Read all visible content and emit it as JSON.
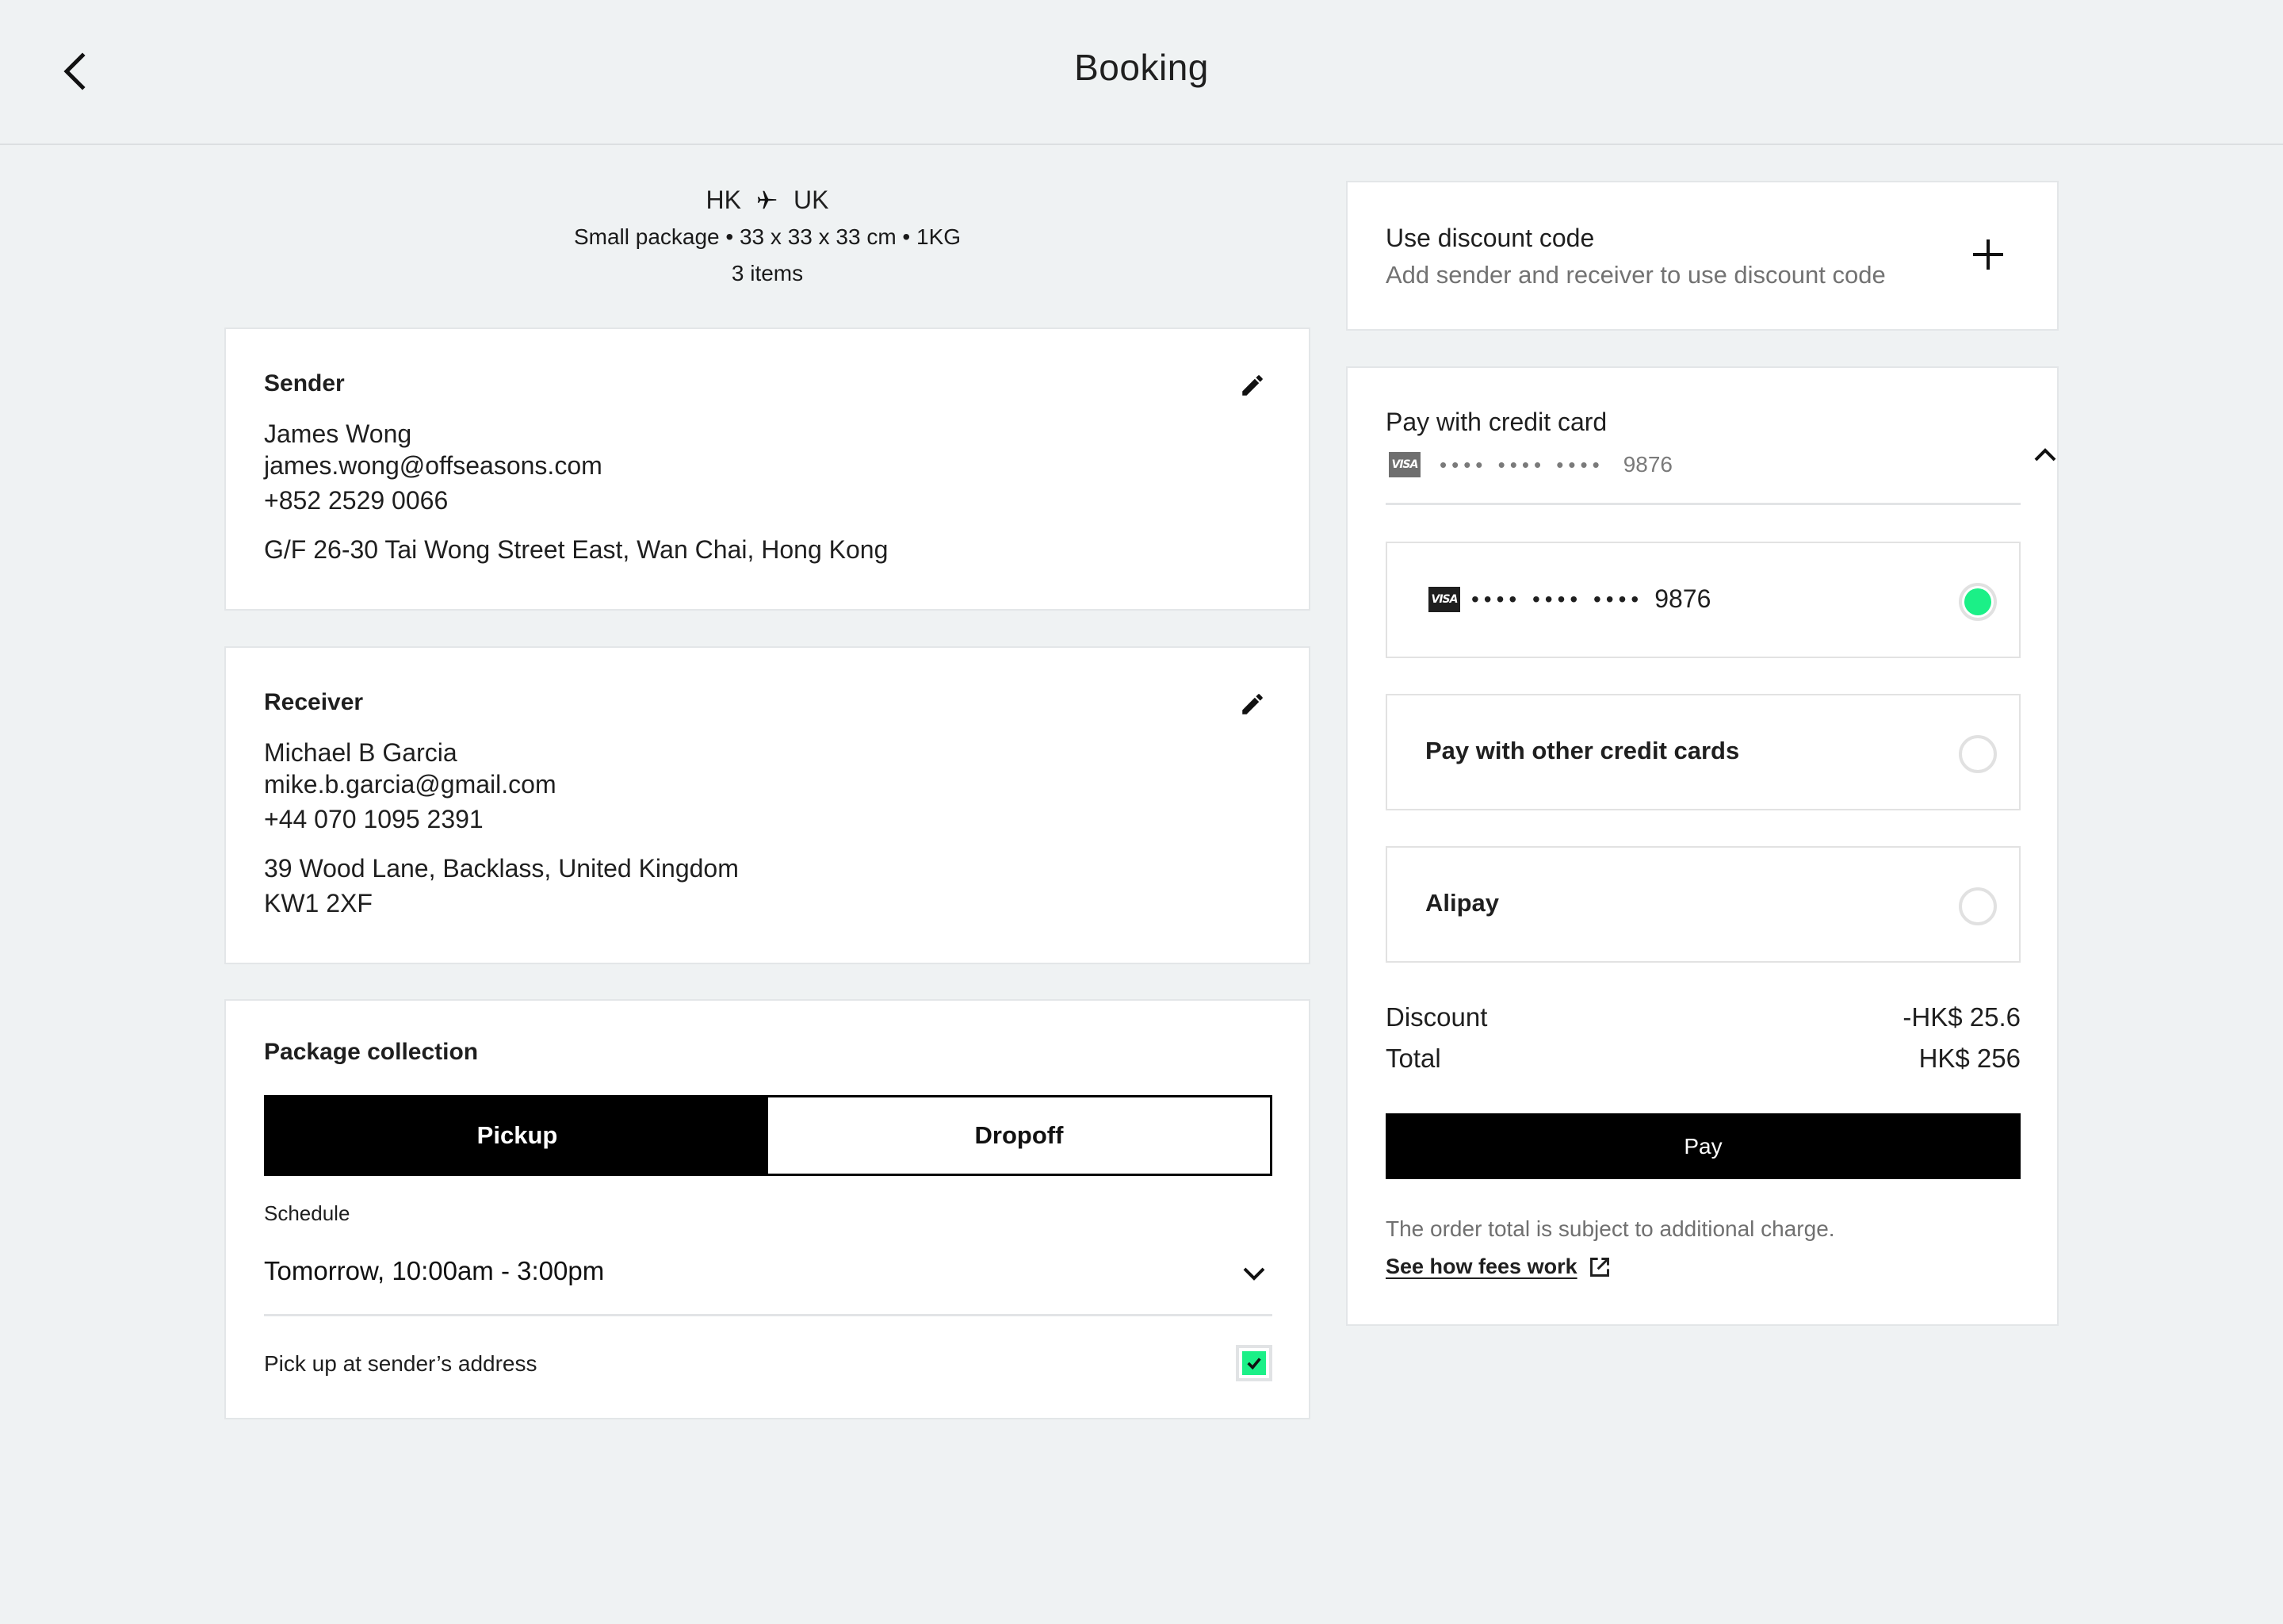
{
  "header": {
    "title": "Booking",
    "back_icon": "chevron-left-icon"
  },
  "summary": {
    "origin": "HK",
    "destination": "UK",
    "route_icon": "airplane-icon",
    "package_desc": "Small package • 33 x 33 x 33 cm • 1KG",
    "items": "3 items"
  },
  "sender": {
    "title": "Sender",
    "name": "James Wong",
    "email": "james.wong@offseasons.com",
    "phone": "+852  2529 0066",
    "address_line1": "G/F 26-30 Tai Wong Street East, Wan Chai, Hong Kong"
  },
  "receiver": {
    "title": "Receiver",
    "name": "Michael B Garcia",
    "email": "mike.b.garcia@gmail.com",
    "phone": "+44 070 1095 2391",
    "address_line1": "39 Wood Lane, Backlass,  United Kingdom",
    "address_line2": "KW1 2XF"
  },
  "collection": {
    "title": "Package collection",
    "options": [
      {
        "label": "Pickup",
        "selected": true
      },
      {
        "label": "Dropoff",
        "selected": false
      }
    ],
    "schedule_label": "Schedule",
    "schedule_value": "Tomorrow, 10:00am - 3:00pm",
    "pickup_at_sender_label": "Pick up at sender’s address",
    "pickup_at_sender_checked": true
  },
  "discount": {
    "title": "Use discount code",
    "subtitle": "Add sender and receiver to use discount code"
  },
  "payment": {
    "title": "Pay with credit card",
    "card_brand": "VISA",
    "masked_digits": "•••• •••• ••••",
    "last4": "9876",
    "options": [
      {
        "label": "•••• •••• •••• 9876",
        "selected": true
      },
      {
        "label": "Pay with other credit cards",
        "selected": false
      },
      {
        "label": "Alipay",
        "selected": false
      }
    ],
    "discount_label": "Discount",
    "discount_value": "-HK$ 25.6",
    "total_label": "Total",
    "total_value": "HK$ 256",
    "pay_button": "Pay",
    "fee_note": "The order total is subject to additional charge.",
    "fee_link": "See how fees work"
  },
  "colors": {
    "background": "#eff2f3",
    "accent_green": "#1bf087",
    "primary_black": "#000000",
    "muted_text": "#727272"
  }
}
